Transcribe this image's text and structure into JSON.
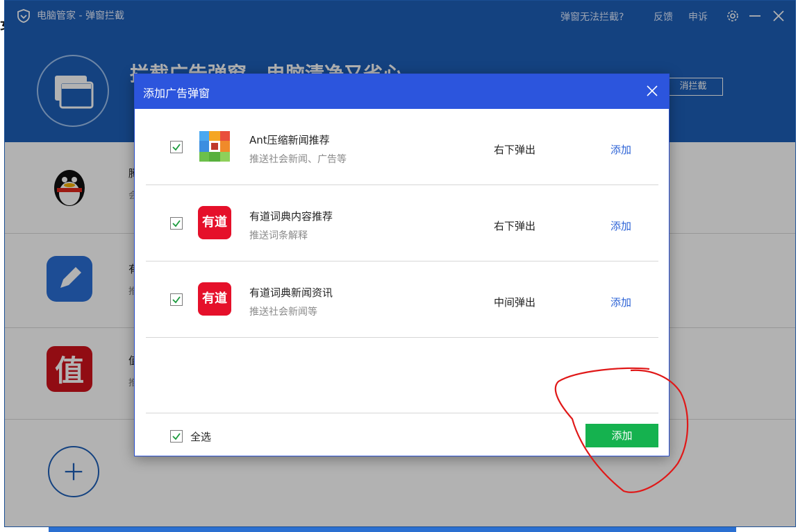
{
  "titlebar": {
    "title": "电脑管家 - 弹窗拦截",
    "links": [
      "弹窗无法拦截?",
      "反馈",
      "申诉"
    ],
    "logo_icon": "shield-heart-icon",
    "settings_icon": "gear-icon",
    "minimize_icon": "minimize-icon",
    "close_icon": "close-icon"
  },
  "hero": {
    "headline": "拦截广告弹窗，电脑清净又省心",
    "cancel_label": "消拦截"
  },
  "background_list": {
    "items": [
      {
        "name": "腾",
        "sub": "会",
        "icon": "qq-penguin-icon"
      },
      {
        "name": "有",
        "sub": "推",
        "icon": "pencil-app-icon"
      },
      {
        "name": "值",
        "sub": "推",
        "icon": "zhi-app-icon"
      }
    ],
    "add_icon": "plus-icon"
  },
  "edge_glyph": "女",
  "dialog": {
    "title": "添加广告弹窗",
    "close_icon": "close-icon",
    "items": [
      {
        "name": "Ant压缩新闻推荐",
        "desc": "推送社会新闻、广告等",
        "position": "右下弹出",
        "action": "添加",
        "checked": true,
        "icon": "ant-zip-icon"
      },
      {
        "name": "有道词典内容推荐",
        "desc": "推送词条解释",
        "position": "右下弹出",
        "action": "添加",
        "checked": true,
        "icon": "youdao-icon",
        "icon_text": "有道"
      },
      {
        "name": "有道词典新闻资讯",
        "desc": "推送社会新闻等",
        "position": "中间弹出",
        "action": "添加",
        "checked": true,
        "icon": "youdao-icon",
        "icon_text": "有道"
      }
    ],
    "footer": {
      "select_all_label": "全选",
      "select_all_checked": true,
      "add_button_label": "添加"
    }
  },
  "colors": {
    "brand_blue": "#1e5fb8",
    "dialog_header": "#2c55dd",
    "link_blue": "#2d63d6",
    "add_green": "#15b24f",
    "youdao_red": "#e5102a",
    "annotation_red": "#e01818"
  }
}
